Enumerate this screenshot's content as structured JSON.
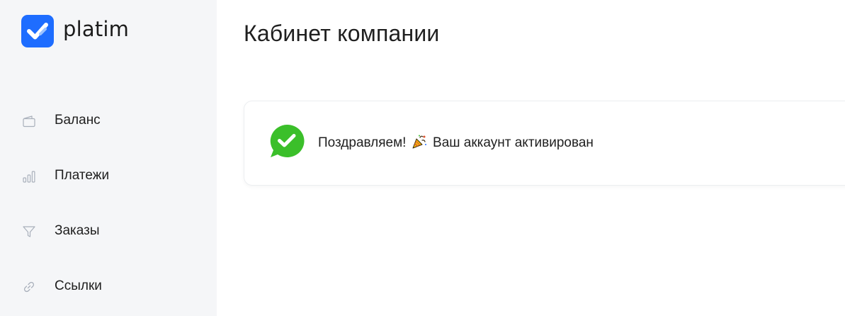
{
  "app": {
    "brand_name": "platim",
    "brand_color": "#1e6dff"
  },
  "sidebar": {
    "items": [
      {
        "label": "Баланс",
        "icon": "wallet-icon"
      },
      {
        "label": "Платежи",
        "icon": "bar-chart-icon"
      },
      {
        "label": "Заказы",
        "icon": "funnel-icon"
      },
      {
        "label": "Ссылки",
        "icon": "link-icon"
      }
    ]
  },
  "main": {
    "title": "Кабинет компании",
    "notice": {
      "text_before": "Поздравляем!",
      "emoji": "party-popper-icon",
      "text_after": "Ваш аккаунт активирован",
      "icon": "success-chat-check-icon",
      "icon_color": "#3bbf2a"
    }
  }
}
